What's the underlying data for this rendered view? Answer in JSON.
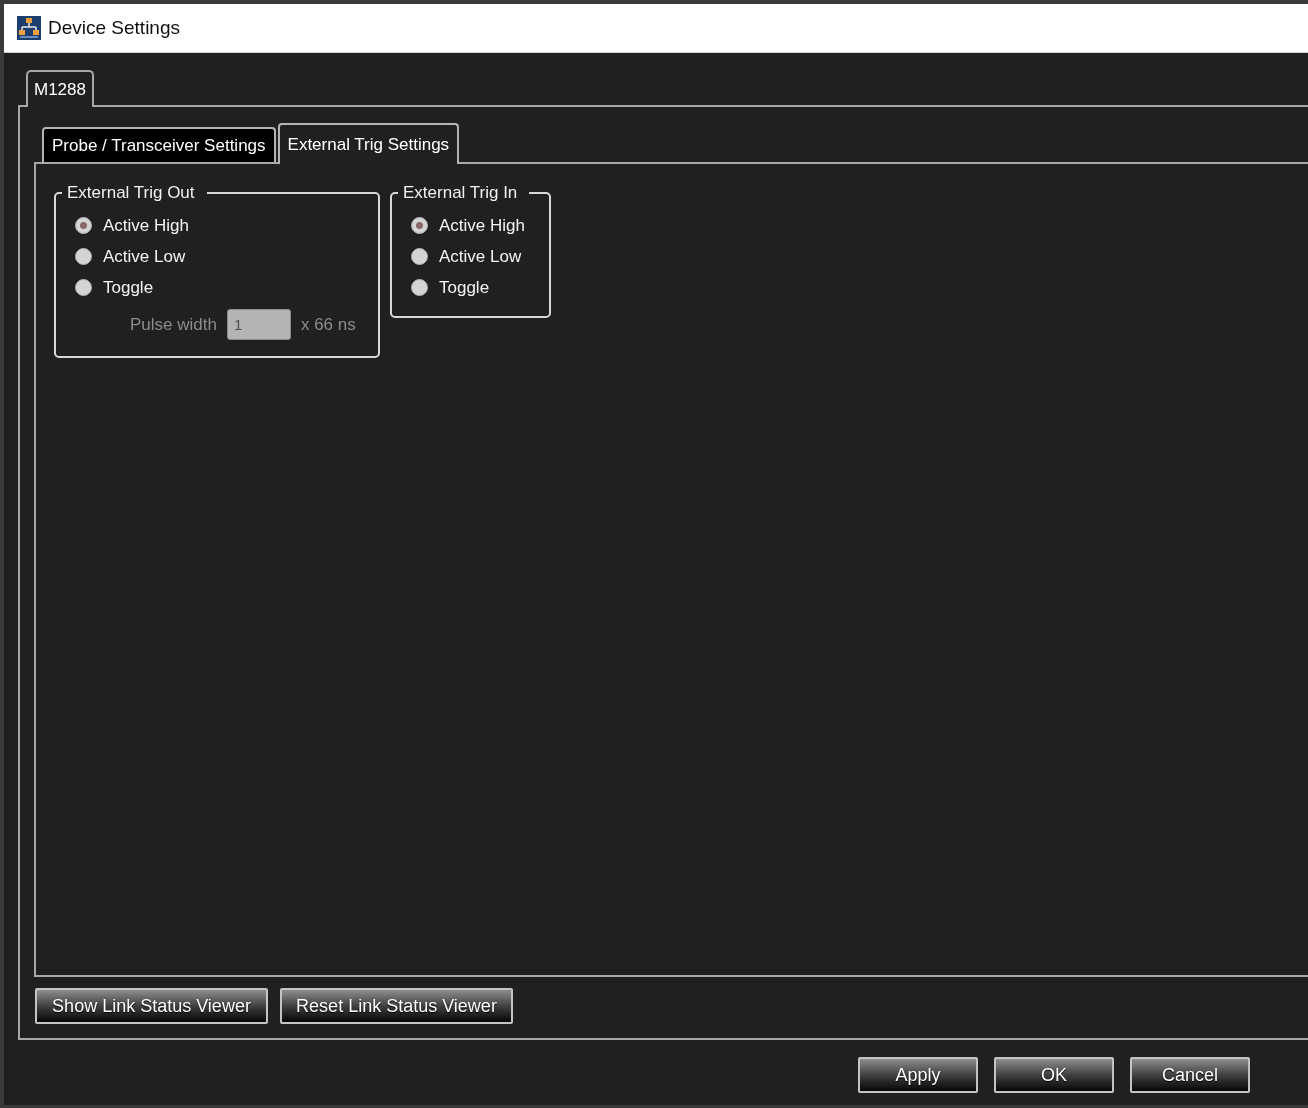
{
  "window": {
    "title": "Device Settings"
  },
  "device_tabs": [
    {
      "label": "M1288",
      "selected": true
    }
  ],
  "settings_tabs": [
    {
      "label": "Probe / Transceiver Settings",
      "selected": false
    },
    {
      "label": "External Trig Settings",
      "selected": true
    }
  ],
  "groups": [
    {
      "title": "External Trig Out",
      "options": [
        {
          "label": "Active High",
          "selected": true
        },
        {
          "label": "Active Low",
          "selected": false
        },
        {
          "label": "Toggle",
          "selected": false
        }
      ],
      "pulse_width": {
        "label": "Pulse width",
        "value": "1",
        "unit": "x 66 ns",
        "disabled": true
      }
    },
    {
      "title": "External Trig In",
      "options": [
        {
          "label": "Active High",
          "selected": true
        },
        {
          "label": "Active Low",
          "selected": false
        },
        {
          "label": "Toggle",
          "selected": false
        }
      ]
    }
  ],
  "link_buttons": [
    "Show Link Status Viewer",
    "Reset Link Status Viewer"
  ],
  "dialog_buttons": [
    "Apply",
    "OK",
    "Cancel"
  ]
}
